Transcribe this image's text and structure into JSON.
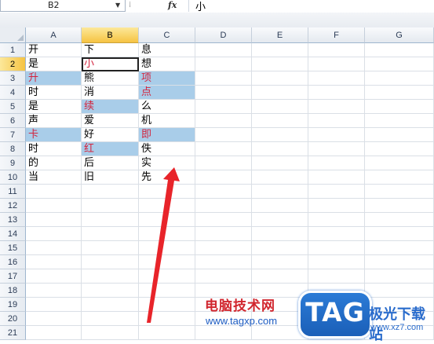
{
  "formula_bar": {
    "name_box": "B2",
    "fx_label": "fx",
    "formula_value": "小"
  },
  "columns": [
    "A",
    "B",
    "C",
    "D",
    "E",
    "F",
    "G"
  ],
  "selected_column": "B",
  "rows": [
    "1",
    "2",
    "3",
    "4",
    "5",
    "6",
    "7",
    "8",
    "9",
    "10",
    "11",
    "12",
    "13",
    "14",
    "15",
    "16",
    "17",
    "18",
    "19",
    "20",
    "21"
  ],
  "selected_row": "2",
  "cells": {
    "A": [
      "开",
      "是",
      "升",
      "时",
      "是",
      "声",
      "卡",
      "时",
      "的",
      "当"
    ],
    "B": [
      "下",
      "小",
      "熊",
      "消",
      "续",
      "爱",
      "好",
      "红",
      "后",
      "旧"
    ],
    "C": [
      "息",
      "想",
      "项",
      "点",
      "么",
      "机",
      "即",
      "佚",
      "实",
      "先"
    ]
  },
  "highlighted": [
    "A3",
    "C3",
    "C4",
    "B5",
    "A7",
    "C7",
    "B8"
  ],
  "red_text": [
    "B2",
    "A3",
    "C3",
    "C4",
    "B5",
    "A7",
    "C7",
    "B8"
  ],
  "active_cell": "B2",
  "colors": {
    "highlight": "#a9cde9",
    "red_text": "#d3243e",
    "arrow": "#e8242a"
  },
  "watermark": {
    "title": "电脑技术网",
    "url": "www.tagxp.com",
    "logo": "TAG",
    "site_name": "极光下载站",
    "site_url": "www.xz7.com"
  }
}
